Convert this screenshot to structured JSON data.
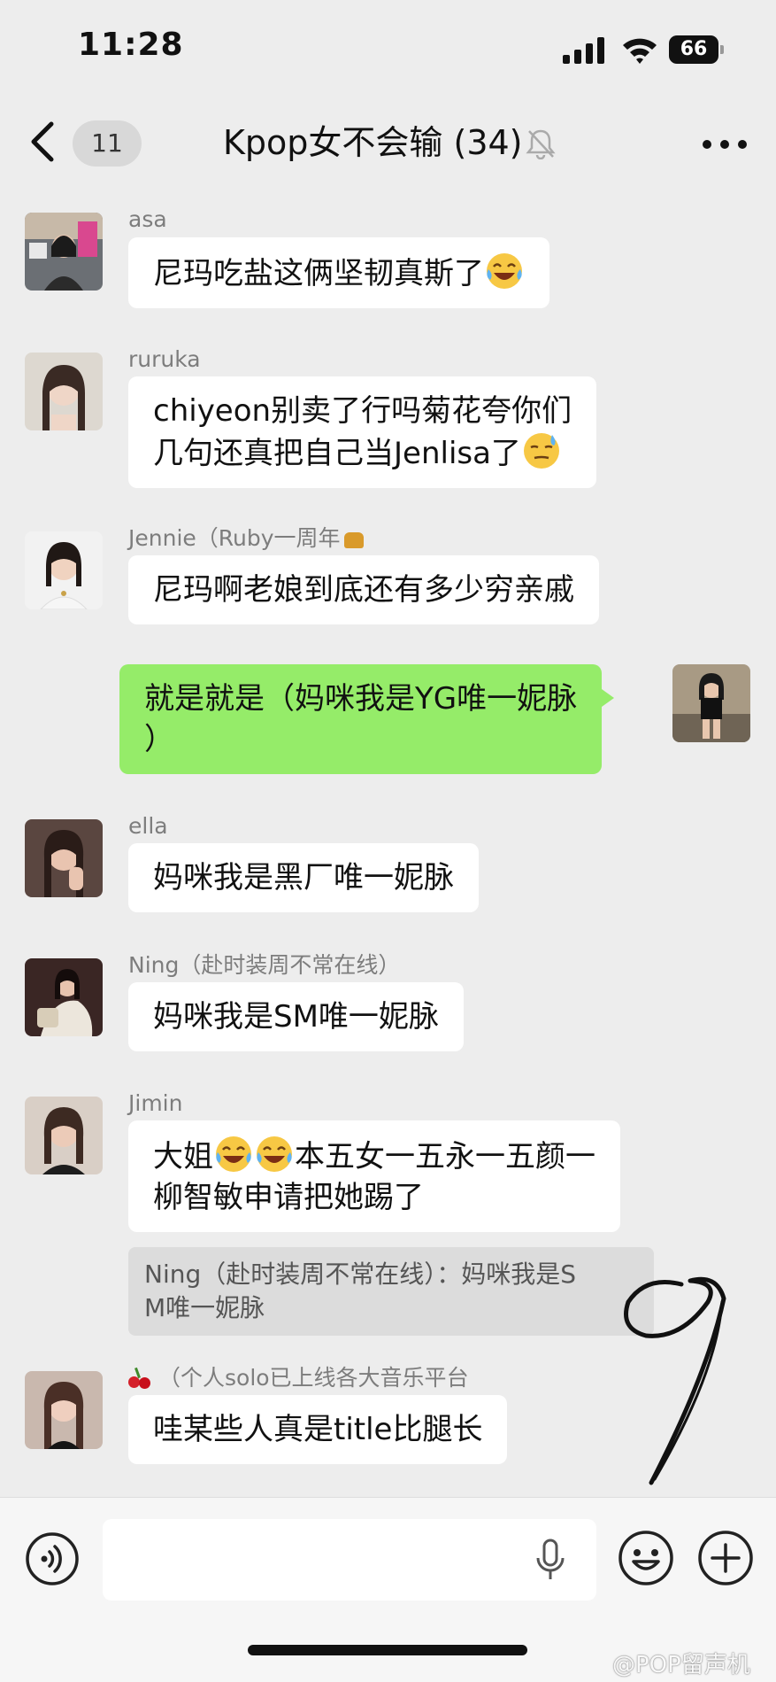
{
  "status_bar": {
    "time": "11:28",
    "battery": "66"
  },
  "nav": {
    "unread_count": "11",
    "title": "Kpop女不会输 (34)"
  },
  "messages": [
    {
      "sender": "asa",
      "text": "尼玛吃盐这俩坚韧真斯了",
      "emoji": "laugh-cry"
    },
    {
      "sender": "ruruka",
      "line1": "chiyeon别卖了行吗菊花夸你们",
      "line2": "几句还真把自己当Jenlisa了",
      "emoji": "sweat-smile"
    },
    {
      "sender": "Jennie（Ruby一周年",
      "text": "尼玛啊老娘到底还有多少穷亲戚"
    },
    {
      "sender": "me",
      "line1": "就是就是（妈咪我是YG唯一妮脉",
      "line2": "）"
    },
    {
      "sender": "ella",
      "text": "妈咪我是黑厂唯一妮脉"
    },
    {
      "sender": "Ning（赴时装周不常在线）",
      "text": "妈咪我是SM唯一妮脉"
    },
    {
      "sender": "Jimin",
      "line1_a": "大姐",
      "line1_b": "本五女一五永一五颜一",
      "line2": "柳智敏申请把她踢了",
      "quote_line1": "Ning（赴时装周不常在线）：妈咪我是S",
      "quote_line2": "M唯一妮脉"
    },
    {
      "sender": "（个人solo已上线各大音乐平台",
      "text": "哇某些人真是title比腿长"
    }
  ],
  "input": {
    "placeholder": ""
  },
  "watermark": "@POP留声机",
  "colors": {
    "background": "#ededed",
    "my_bubble": "#95ec69",
    "their_bubble": "#ffffff"
  }
}
